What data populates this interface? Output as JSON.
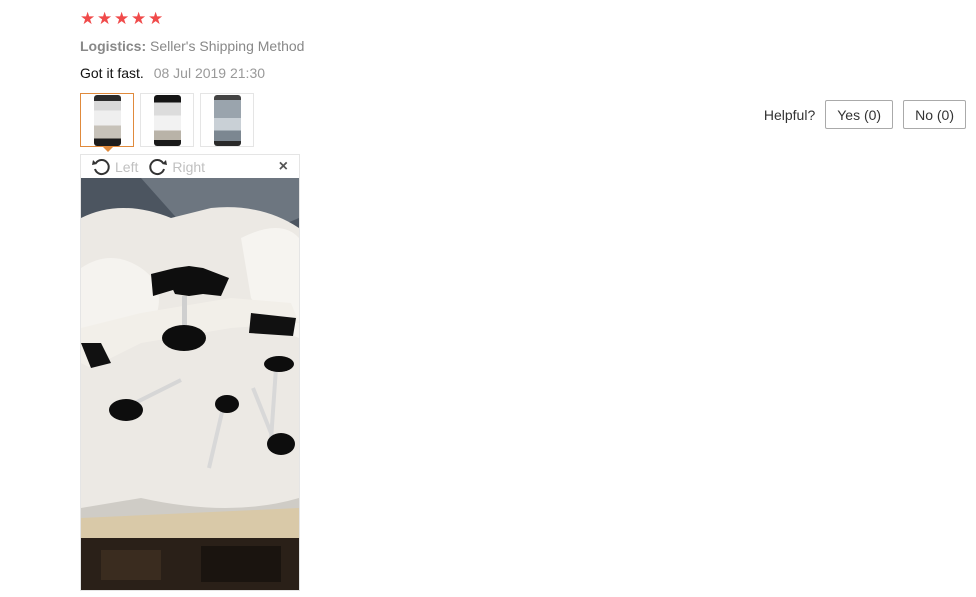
{
  "review": {
    "rating": 5,
    "stars": [
      "★",
      "★",
      "★",
      "★",
      "★"
    ],
    "logistics_label": "Logistics:",
    "logistics_value": "Seller's Shipping Method",
    "text": "Got it fast.",
    "date": "08 Jul 2019 21:30"
  },
  "helpful": {
    "label": "Helpful?",
    "yes": "Yes (0)",
    "no": "No (0)"
  },
  "viewer": {
    "rotate_left": "Left",
    "rotate_right": "Right",
    "close": "×"
  },
  "colors": {
    "star": "#f04a4a",
    "active_thumb_border": "#e08a3c"
  }
}
